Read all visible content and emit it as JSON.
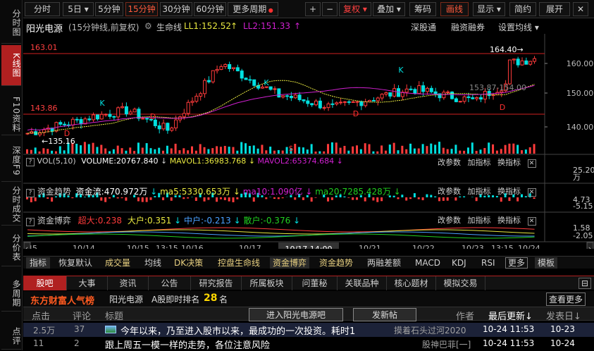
{
  "left_tabs": [
    {
      "label": "分时图"
    },
    {
      "label": "K线图"
    },
    {
      "label": "F10资料"
    },
    {
      "label": "深度F9"
    },
    {
      "label": "分时成交"
    },
    {
      "label": "分价表"
    },
    {
      "label": "多周期"
    },
    {
      "label": "点评"
    }
  ],
  "toolbar": {
    "periods": [
      "分时",
      "5日",
      "5分钟",
      "15分钟",
      "30分钟",
      "60分钟",
      "更多周期"
    ],
    "plus": "+",
    "minus": "−",
    "fuquan": "复权",
    "diejia": "叠加",
    "chouma": "筹码",
    "huaxian": "画线",
    "xianshi": "显示",
    "jianyue": "简约",
    "zhankai": "展开"
  },
  "info": {
    "stock": "阳光电源",
    "period_note": "(15分钟线,前复权)",
    "life_label": "生命线",
    "ll1": "LL1:152.52",
    "ll2": "LL2:151.33",
    "shendu": "深股通",
    "rongzi": "融资融券",
    "shezhi": "设置均线 ▾"
  },
  "chart": {
    "price_hi": "163.01",
    "price_lo": "143.86",
    "max_label": "164.40→",
    "min_label": "←135.16",
    "cursor_label": "10/17,14:00",
    "y_labels": [
      "160.00",
      "150.00",
      "140.00"
    ],
    "crosshair_text": "153.87-154.00",
    "x_labels": [
      "45",
      "10/14",
      "10/15",
      "13:15",
      "10/16",
      "10/17",
      "10/21",
      "10/22",
      "10/23",
      "13:15",
      "10/24"
    ],
    "markers": [
      "K",
      "K",
      "K",
      "D",
      "D",
      "D",
      "D",
      "$"
    ]
  },
  "vol_panel": {
    "name": "VOL(5,10)",
    "volume": "VOLUME:20767.840",
    "mavol1": "MAVOL1:36983.768",
    "mavol2": "MAVOL2:65374.684",
    "canshu": "改参数",
    "addind": "加指标",
    "swapind": "换指标",
    "yl": [
      "25.20",
      "万"
    ]
  },
  "fund_panel": {
    "name": "资金趋势",
    "jl": "资金流:470.972万",
    "ma5": "ma5:5330.653万",
    "ma10": "ma10:1.090亿",
    "ma20": "ma20:7285.428万",
    "canshu": "改参数",
    "addind": "加指标",
    "swapind": "换指标",
    "yl": [
      "4.73",
      "-5.15"
    ]
  },
  "game_panel": {
    "name": "资金博弈",
    "cd": "超大:0.238",
    "dh": "大户:0.351",
    "zh": "中户:-0.213",
    "sh": "散户:-0.376",
    "canshu": "改参数",
    "addind": "加指标",
    "swapind": "换指标",
    "yl": [
      "1.58",
      "-2.05"
    ]
  },
  "ind_tabs": [
    "指标",
    "恢复默认",
    "成交量",
    "均线",
    "DK决策",
    "控盘生命线",
    "资金博弈",
    "资金趋势",
    "两融差额",
    "MACD",
    "KDJ",
    "RSI",
    "更多",
    "模板"
  ],
  "bar_tabs": [
    "股吧",
    "大事",
    "资讯",
    "公告",
    "研究报告",
    "所属板块",
    "问董秘",
    "关联品种",
    "核心题材",
    "模拟交易"
  ],
  "hot": {
    "title": "东方财富人气榜",
    "stock": "阳光电源",
    "rank_label": "A股即时排名",
    "rank": "28",
    "rank_unit": "名",
    "view_more": "查看更多"
  },
  "table": {
    "headers": [
      "点击",
      "评论",
      "标题",
      "作者",
      "最后更新↓",
      "发表日↓"
    ],
    "enter": "进入阳光电源吧",
    "post": "发新帖",
    "rows": [
      {
        "clicks": "2.5万",
        "comments": "37",
        "title": "今年以来，乃至进入股市以来，最成功的一次投资。耗时1",
        "author": "摸着石头过河2020",
        "updated": "10-24 11:53",
        "date": "10-23"
      },
      {
        "clicks": "11",
        "comments": "2",
        "title": "跟上周五一模一样的走势，各位注意风险",
        "author": "股神巴菲[一]",
        "updated": "10-24 11:53",
        "date": "10-24"
      }
    ]
  },
  "colors": {
    "up": "#ff3b3b",
    "down": "#00e0e0",
    "ma_yellow": "#e8e840",
    "ma_purple": "#d020d0",
    "accent": "#b02020"
  }
}
